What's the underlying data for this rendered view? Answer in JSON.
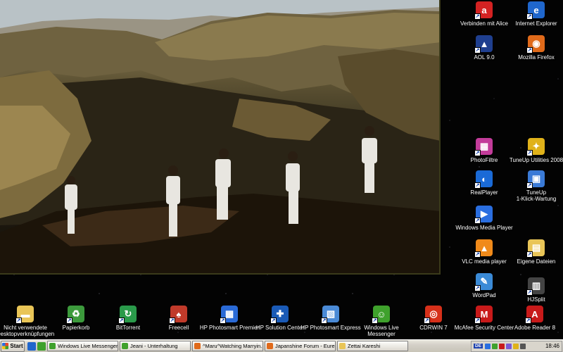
{
  "desktop": {
    "right_icons": [
      {
        "label": "Verbinden mit Alice",
        "icon": "alice-icon",
        "color": "#d42222",
        "glyph": "a"
      },
      {
        "label": "Internet Explorer",
        "icon": "internet-explorer-icon",
        "color": "#1f66cc",
        "glyph": "e"
      },
      {
        "label": "AOL 9.0",
        "icon": "aol-icon",
        "color": "#1f3f8f",
        "glyph": "▲"
      },
      {
        "label": "Mozilla Firefox",
        "icon": "firefox-icon",
        "color": "#e06a1a",
        "glyph": "◉"
      },
      {
        "label": "PhotoFiltre",
        "icon": "photofiltre-icon",
        "color": "#c33c9a",
        "glyph": "▦"
      },
      {
        "label": "TuneUp Utilities 2008",
        "icon": "tuneup-utilities-icon",
        "color": "#e0b21a",
        "glyph": "✦"
      },
      {
        "label": "RealPlayer",
        "icon": "realplayer-icon",
        "color": "#1a6ad6",
        "glyph": "◐"
      },
      {
        "label": "TuneUp\n1-Klick-Wartung",
        "icon": "tuneup-1click-icon",
        "color": "#3a7ad6",
        "glyph": "▣"
      },
      {
        "label": "Windows Media Player",
        "icon": "windows-media-player-icon",
        "color": "#2a6ee0",
        "glyph": "▶"
      },
      {
        "label": "VLC media player",
        "icon": "vlc-icon",
        "color": "#f08a1a",
        "glyph": "▲"
      },
      {
        "label": "Eigene Dateien",
        "icon": "my-documents-icon",
        "color": "#e9c557",
        "glyph": "▤"
      },
      {
        "label": "WordPad",
        "icon": "wordpad-icon",
        "color": "#3a8ad6",
        "glyph": "✎"
      },
      {
        "label": "HJSplit",
        "icon": "hjsplit-icon",
        "color": "#444444",
        "glyph": "▥"
      }
    ],
    "bottom_icons": [
      {
        "label": "Nicht verwendete\nDesktopverknüpfungen",
        "icon": "folder-icon",
        "color": "#e9c557",
        "glyph": "▬"
      },
      {
        "label": "Papierkorb",
        "icon": "recycle-bin-icon",
        "color": "#3c9a3c",
        "glyph": "♻"
      },
      {
        "label": "BitTorrent",
        "icon": "bittorrent-icon",
        "color": "#2a9a4a",
        "glyph": "↻"
      },
      {
        "label": "Freecell",
        "icon": "freecell-icon",
        "color": "#c03a2a",
        "glyph": "♠"
      },
      {
        "label": "HP Photosmart Premier",
        "icon": "hp-photosmart-premier-icon",
        "color": "#2a6ad6",
        "glyph": "▦"
      },
      {
        "label": "HP Solution Center",
        "icon": "hp-solution-center-icon",
        "color": "#1a5ab6",
        "glyph": "✚"
      },
      {
        "label": "HP Photosmart Express",
        "icon": "hp-photosmart-express-icon",
        "color": "#4a8ad6",
        "glyph": "▧"
      },
      {
        "label": "Windows Live\nMessenger",
        "icon": "windows-live-messenger-icon",
        "color": "#3fa12c",
        "glyph": "☺"
      },
      {
        "label": "CDRWIN 7",
        "icon": "cdrwin-icon",
        "color": "#d6301a",
        "glyph": "◎"
      },
      {
        "label": "McAfee Security Center",
        "icon": "mcafee-icon",
        "color": "#c81a1a",
        "glyph": "M"
      },
      {
        "label": "Adobe Reader 8",
        "icon": "adobe-reader-icon",
        "color": "#c81a1a",
        "glyph": "A"
      }
    ]
  },
  "taskbar": {
    "start_label": "Start",
    "tasks": [
      {
        "label": "Windows Live Messenger",
        "color": "#3fa12c"
      },
      {
        "label": "Jeani - Unterhaltung",
        "color": "#3fa12c"
      },
      {
        "label": "^Maru^Watching Marryin...",
        "color": "#e06a1a"
      },
      {
        "label": "Japanshine Forum - Eure ...",
        "color": "#e06a1a"
      },
      {
        "label": "Zettai Kareshi",
        "color": "#e9c557"
      }
    ],
    "tray": {
      "language": "DE",
      "clock": "18:46"
    }
  }
}
